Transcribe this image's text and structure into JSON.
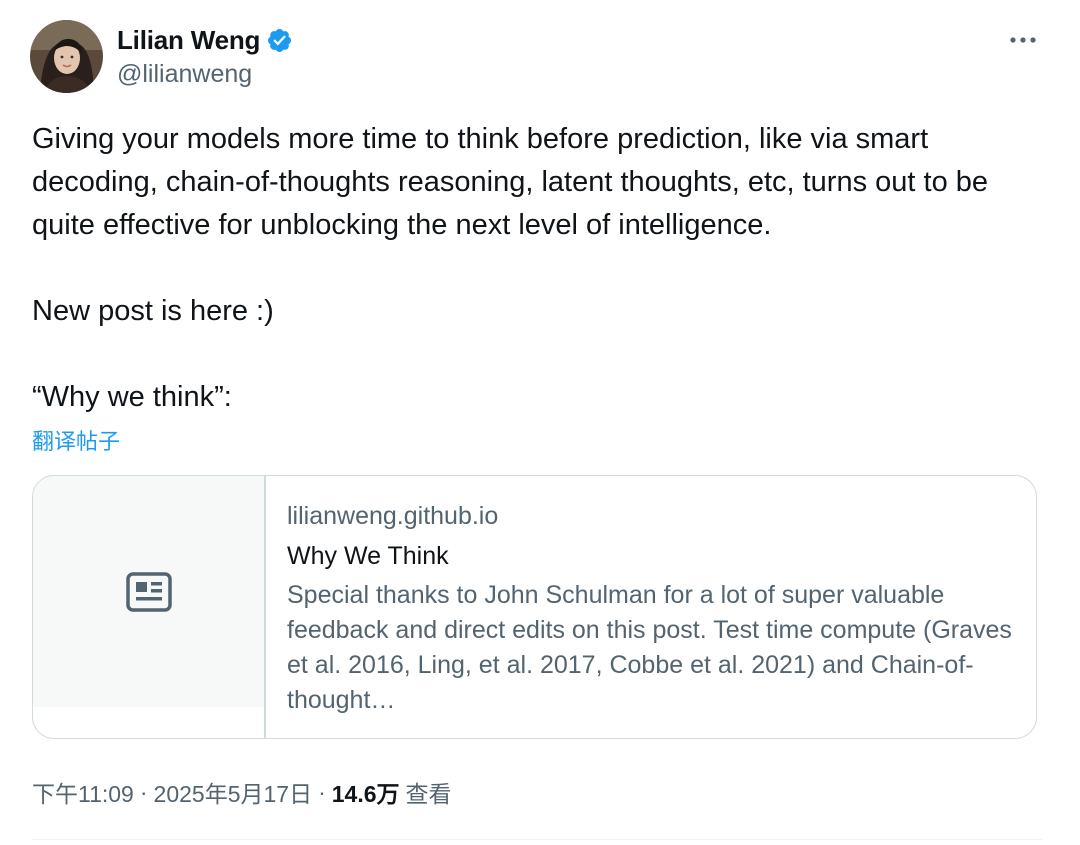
{
  "author": {
    "display_name": "Lilian Weng",
    "handle": "@lilianweng",
    "verified": true,
    "avatar_icon": "profile-photo"
  },
  "more_icon": "more-horizontal-icon",
  "tweet": {
    "paragraphs": [
      "Giving your models more time to think before prediction, like via smart decoding, chain-of-thoughts reasoning, latent thoughts, etc, turns out to be quite effective for unblocking the next level of intelligence.",
      "New post is here :)",
      "“Why we think”:"
    ],
    "translate_label": "翻译帖子"
  },
  "link_card": {
    "thumbnail_icon": "article-icon",
    "domain": "lilianweng.github.io",
    "title": "Why We Think",
    "description": "Special thanks to John Schulman for a lot of super valuable feedback and direct edits on this post. Test time compute (Graves et al. 2016, Ling, et al. 2017, Cobbe et al. 2021) and Chain-of-thought…"
  },
  "meta": {
    "time": "下午11:09",
    "separator": "·",
    "date": "2025年5月17日",
    "views_count": "14.6万",
    "views_label": "查看"
  },
  "colors": {
    "text_primary": "#0f1419",
    "text_secondary": "#536471",
    "accent": "#1d9bf0",
    "border": "#cfd9de",
    "card_thumb_bg": "#f7f9f9"
  }
}
